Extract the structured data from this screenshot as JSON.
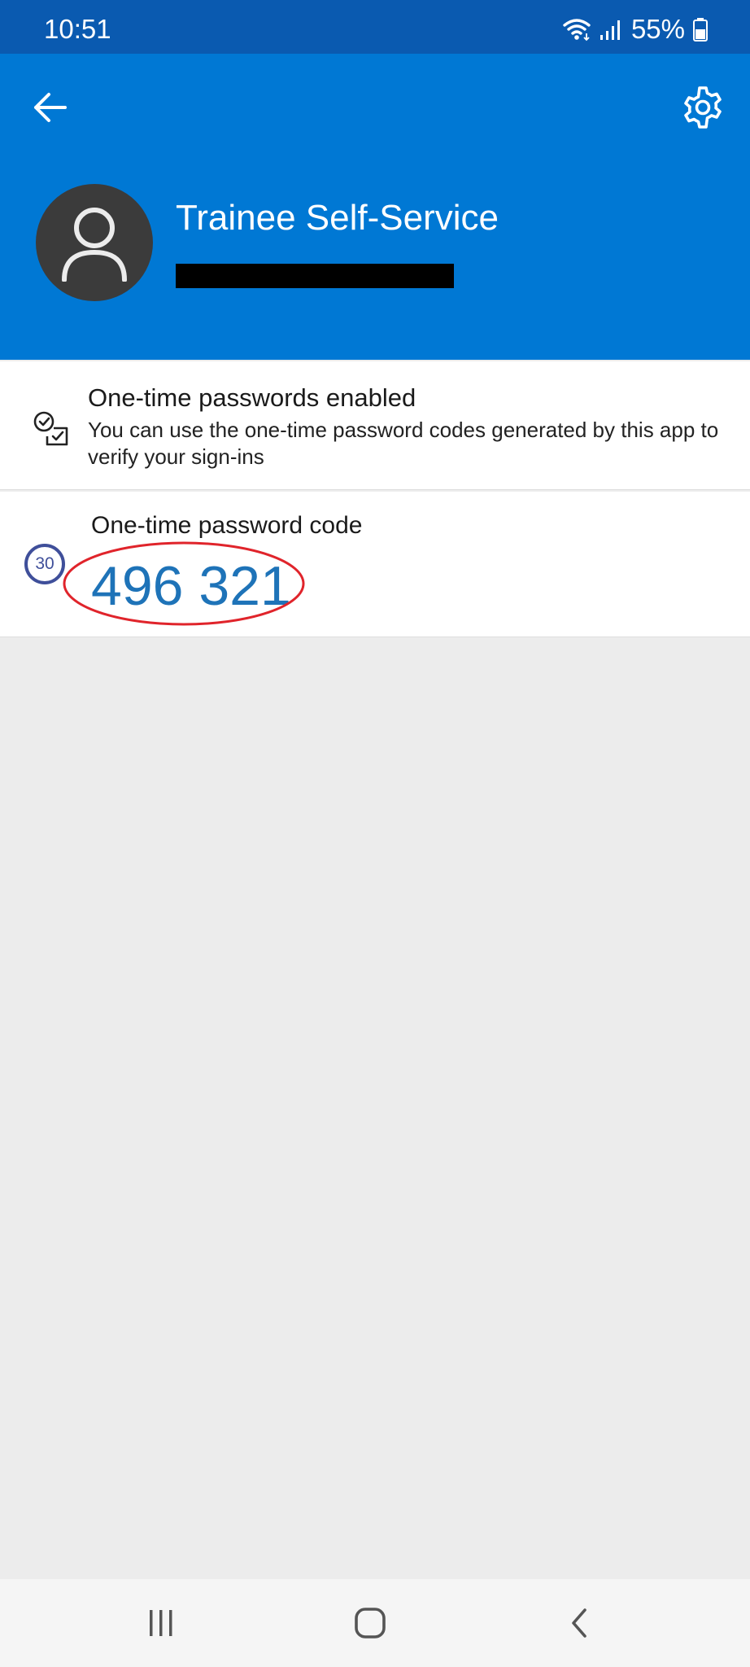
{
  "status_bar": {
    "time": "10:51",
    "battery_percent": "55%",
    "icons": [
      "wifi-icon",
      "signal-icon",
      "battery-icon"
    ]
  },
  "header": {
    "back_icon": "arrow-left-icon",
    "settings_icon": "gear-icon",
    "avatar_icon": "person-icon",
    "account_name": "Trainee Self-Service",
    "background_color": "#0078d4"
  },
  "otp_status": {
    "icon": "checklist-icon",
    "title": "One-time passwords enabled",
    "description": "You can use the one-time password codes generated by this app to verify your sign-ins"
  },
  "otp_code": {
    "timer_seconds": "30",
    "label": "One-time password code",
    "code": "496 321",
    "code_color": "#1e73b8",
    "highlight_color": "#e0242b"
  },
  "nav_bar": {
    "icons": [
      "recents-icon",
      "home-icon",
      "back-icon"
    ]
  }
}
